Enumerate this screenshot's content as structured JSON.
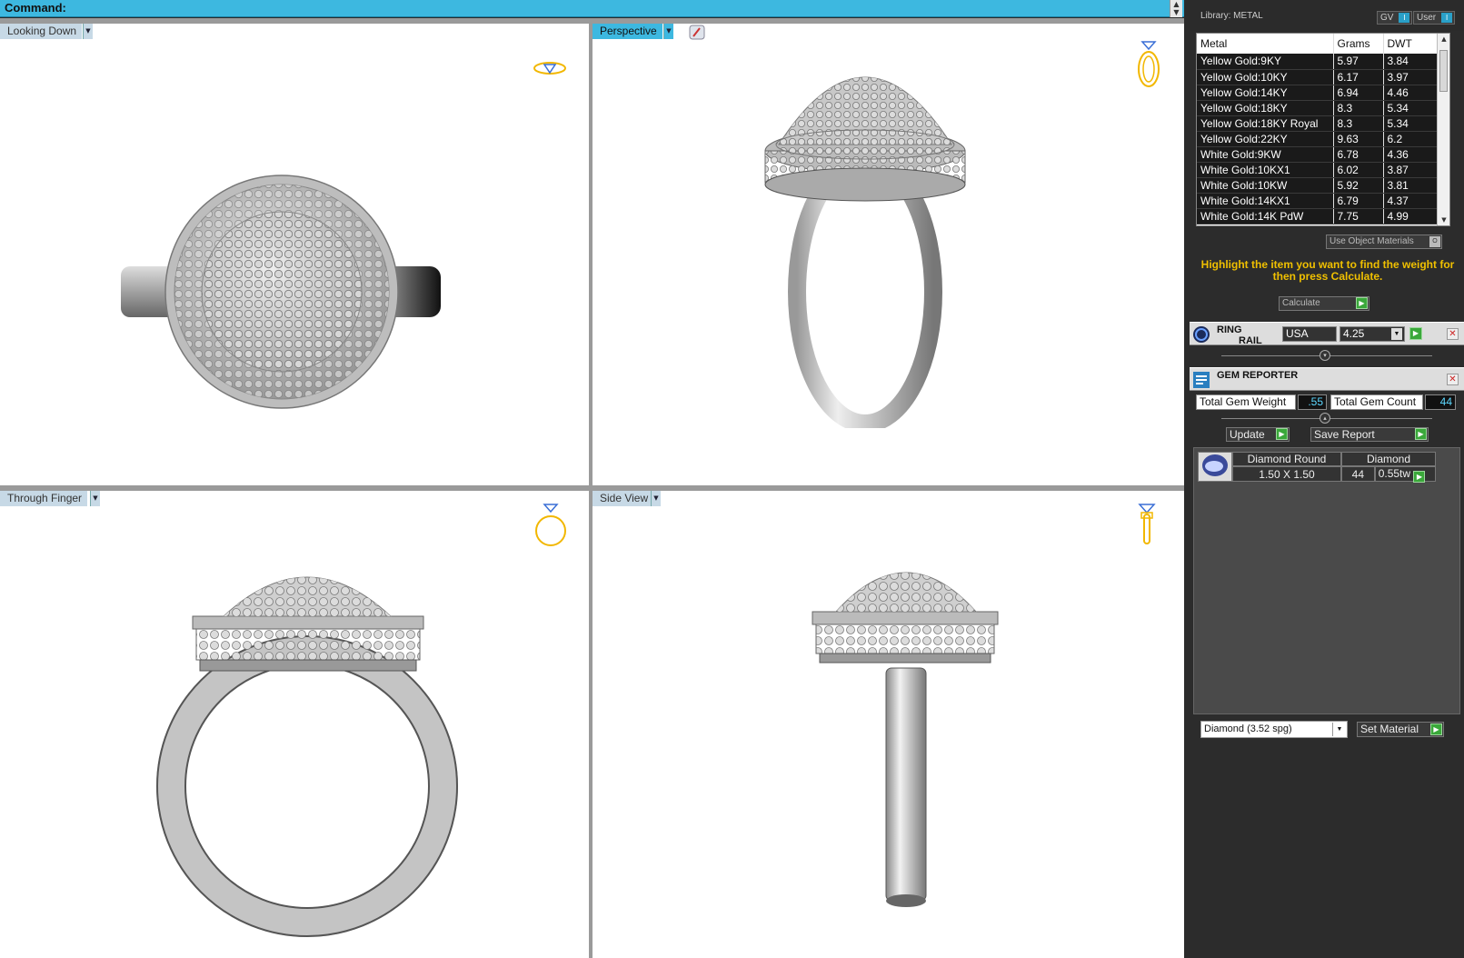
{
  "command": {
    "label": "Command:"
  },
  "viewports": {
    "top_left": {
      "label": "Looking Down"
    },
    "top_right": {
      "label": "Perspective"
    },
    "bottom_left": {
      "label": "Through Finger"
    },
    "bottom_right": {
      "label": "Side View"
    }
  },
  "library": {
    "title": "Library: METAL",
    "btn_gv": "GV",
    "btn_user": "User",
    "columns": [
      "Metal",
      "Grams",
      "DWT"
    ],
    "rows": [
      [
        "Yellow Gold:9KY",
        "5.97",
        "3.84"
      ],
      [
        "Yellow Gold:10KY",
        "6.17",
        "3.97"
      ],
      [
        "Yellow Gold:14KY",
        "6.94",
        "4.46"
      ],
      [
        "Yellow Gold:18KY",
        "8.3",
        "5.34"
      ],
      [
        "Yellow Gold:18KY Royal",
        "8.3",
        "5.34"
      ],
      [
        "Yellow Gold:22KY",
        "9.63",
        "6.2"
      ],
      [
        "White Gold:9KW",
        "6.78",
        "4.36"
      ],
      [
        "White Gold:10KX1",
        "6.02",
        "3.87"
      ],
      [
        "White Gold:10KW",
        "5.92",
        "3.81"
      ],
      [
        "White Gold:14KX1",
        "6.79",
        "4.37"
      ],
      [
        "White Gold:14K PdW",
        "7.75",
        "4.99"
      ]
    ],
    "use_object_materials": "Use Object Materials",
    "hint": "Highlight the item you want to find the weight for then press Calculate.",
    "calculate": "Calculate"
  },
  "ring_rail": {
    "title_line1": "RING",
    "title_line2": "RAIL",
    "region": "USA",
    "size": "4.25"
  },
  "gem_reporter": {
    "title": "GEM REPORTER",
    "total_weight_label": "Total Gem Weight",
    "total_weight_value": ".55",
    "total_count_label": "Total Gem Count",
    "total_count_value": "44",
    "update": "Update",
    "save_report": "Save Report",
    "gem": {
      "cut": "Diamond Round",
      "material": "Diamond",
      "size": "1.50 X 1.50",
      "count": "44",
      "weight": "0.55tw"
    }
  },
  "material_select": {
    "value": "Diamond     (3.52 spg)",
    "set_button": "Set Material"
  }
}
